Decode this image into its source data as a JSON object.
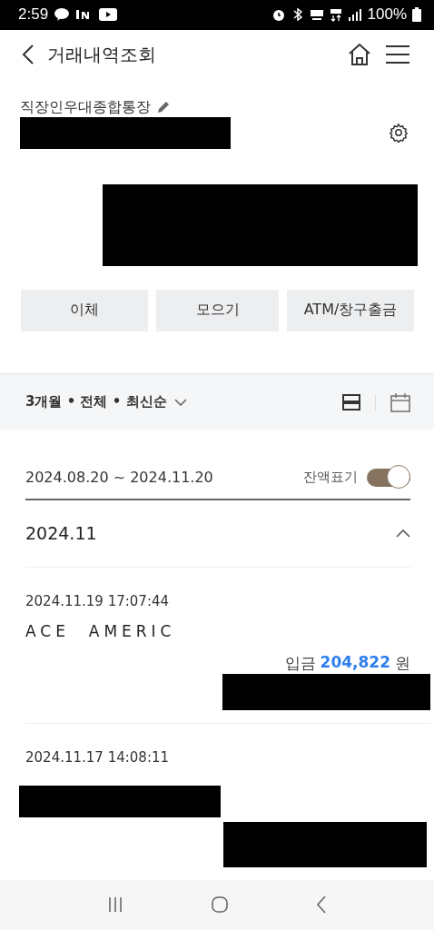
{
  "status_bar": {
    "time": "2:59",
    "battery": "100%"
  },
  "header": {
    "title": "거래내역조회"
  },
  "account": {
    "name": "직장인우대종합통장"
  },
  "actions": [
    "이체",
    "모으기",
    "ATM/창구출금"
  ],
  "filter": {
    "label": "3개월 • 전체 • 최신순"
  },
  "period": {
    "range": "2024.08.20 ~ 2024.11.20",
    "balance_toggle": {
      "label": "잔액표기",
      "on": true
    }
  },
  "months": [
    {
      "label": "2024.11",
      "expanded": true,
      "transactions": [
        {
          "datetime": "2024.11.19 17:07:44",
          "description": "ACE  AMERIC",
          "type": "입금",
          "amount": "204,822",
          "unit": "원"
        },
        {
          "datetime": "2024.11.17 14:08:11"
        }
      ]
    }
  ]
}
